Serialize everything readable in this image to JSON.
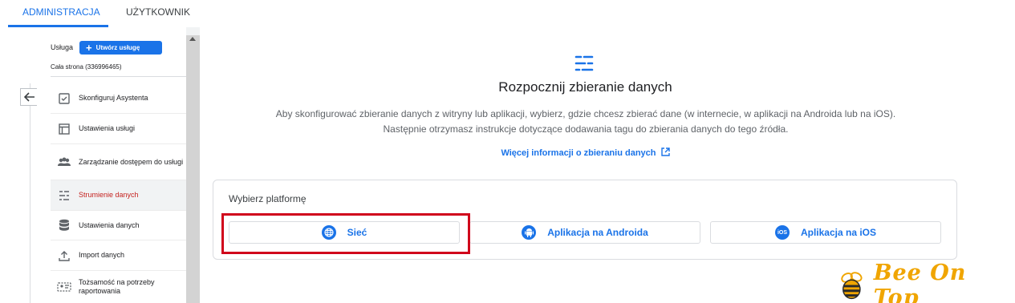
{
  "tabs": [
    {
      "label": "ADMINISTRACJA",
      "active": true
    },
    {
      "label": "UŻYTKOWNIK",
      "active": false
    }
  ],
  "sidebar": {
    "property_label": "Usługa",
    "create_button": "Utwórz usługę",
    "property_name": "Cała strona (336996465)",
    "items": [
      {
        "label": "Skonfiguruj Asystenta",
        "icon": "checklist-icon"
      },
      {
        "label": "Ustawienia usługi",
        "icon": "layout-icon"
      },
      {
        "label": "Zarządzanie dostępem do usługi",
        "icon": "people-icon"
      },
      {
        "label": "Strumienie danych",
        "icon": "streams-icon",
        "active": true
      },
      {
        "label": "Ustawienia danych",
        "icon": "database-icon"
      },
      {
        "label": "Import danych",
        "icon": "upload-icon"
      },
      {
        "label": "Tożsamość na potrzeby raportowania",
        "icon": "identity-icon"
      }
    ]
  },
  "main": {
    "heading": "Rozpocznij zbieranie danych",
    "description_line1": "Aby skonfigurować zbieranie danych z witryny lub aplikacji, wybierz, gdzie chcesz zbierać dane (w internecie, w aplikacji na Androida lub na iOS).",
    "description_line2": "Następnie otrzymasz instrukcje dotyczące dodawania tagu do zbierania danych do tego źródła.",
    "learn_more": "Więcej informacji o zbieraniu danych",
    "platform_title": "Wybierz platformę",
    "platforms": [
      {
        "label": "Sieć",
        "icon": "globe-icon"
      },
      {
        "label": "Aplikacja na Androida",
        "icon": "android-icon"
      },
      {
        "label": "Aplikacja na iOS",
        "icon": "ios-icon",
        "icon_text": "iOS"
      }
    ]
  },
  "logo": {
    "text": "Bee On Top"
  },
  "colors": {
    "accent": "#1a73e8",
    "active_nav": "#c5221f",
    "highlight": "#d0021b",
    "logo": "#f0a500"
  }
}
